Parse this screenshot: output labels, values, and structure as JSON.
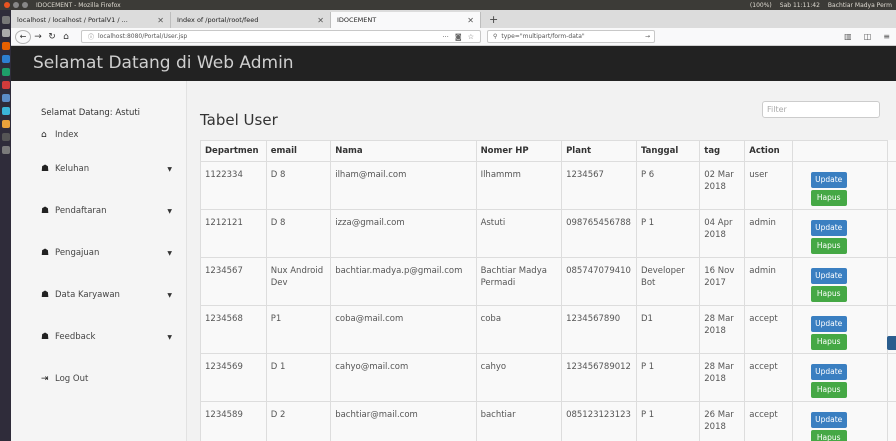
{
  "os": {
    "window_title": "IDOCEMENT - Mozilla Firefox",
    "indicators": [
      "(100%)",
      "Sab 11:11:42",
      "Bachtiar Madya Perm"
    ]
  },
  "browser": {
    "tabs": [
      {
        "label": "localhost / localhost / PortalV1 / ...",
        "active": false
      },
      {
        "label": "Index of /portal/root/feed",
        "active": false
      },
      {
        "label": "IDOCEMENT",
        "active": true
      }
    ],
    "url": "localhost:8080/Portal/User.jsp",
    "search_value": "type=\"multipart/form-data\""
  },
  "app": {
    "header_title": "Selamat Datang di Web Admin",
    "welcome": "Selamat Datang: Astuti",
    "menu": [
      {
        "label": "Index",
        "icon": "home-icon",
        "caret": false
      },
      {
        "label": "Keluhan",
        "icon": "users-icon",
        "caret": true
      },
      {
        "label": "Pendaftaran",
        "icon": "users-icon",
        "caret": true
      },
      {
        "label": "Pengajuan",
        "icon": "users-icon",
        "caret": true
      },
      {
        "label": "Data Karyawan",
        "icon": "users-icon",
        "caret": true
      },
      {
        "label": "Feedback",
        "icon": "users-icon",
        "caret": true
      },
      {
        "label": "Log Out",
        "icon": "logout-icon",
        "caret": false
      }
    ],
    "page_title": "Tabel User",
    "filter_placeholder": "Filter",
    "columns": [
      "Departmen",
      "email",
      "Nama",
      "Nomer HP",
      "Plant",
      "Tanggal",
      "tag",
      "Action"
    ],
    "update_label": "Update",
    "hapus_label": "Hapus",
    "rows": [
      [
        "1122334",
        "D 8",
        "ilham@mail.com",
        "Ilhammm",
        "1234567",
        "P 6",
        "02 Mar 2018",
        "user"
      ],
      [
        "1212121",
        "D 8",
        "izza@gmail.com",
        "Astuti",
        "098765456788",
        "P 1",
        "04 Apr 2018",
        "admin"
      ],
      [
        "1234567",
        "Nux Android Dev",
        "bachtiar.madya.p@gmail.com",
        "Bachtiar Madya Permadi",
        "085747079410",
        "Developer Bot",
        "16 Nov 2017",
        "admin"
      ],
      [
        "1234568",
        "P1",
        "coba@mail.com",
        "coba",
        "1234567890",
        "D1",
        "28 Mar 2018",
        "accept"
      ],
      [
        "1234569",
        "D 1",
        "cahyo@mail.com",
        "cahyo",
        "123456789012",
        "P 1",
        "28 Mar 2018",
        "accept"
      ],
      [
        "1234589",
        "D 2",
        "bachtiar@mail.com",
        "bachtiar",
        "085123123123",
        "P 1",
        "26 Mar 2018",
        "accept"
      ]
    ]
  },
  "colors": {
    "header_bg": "#222222",
    "update_button": "#3a7fc1",
    "hapus_button": "#45a845"
  }
}
